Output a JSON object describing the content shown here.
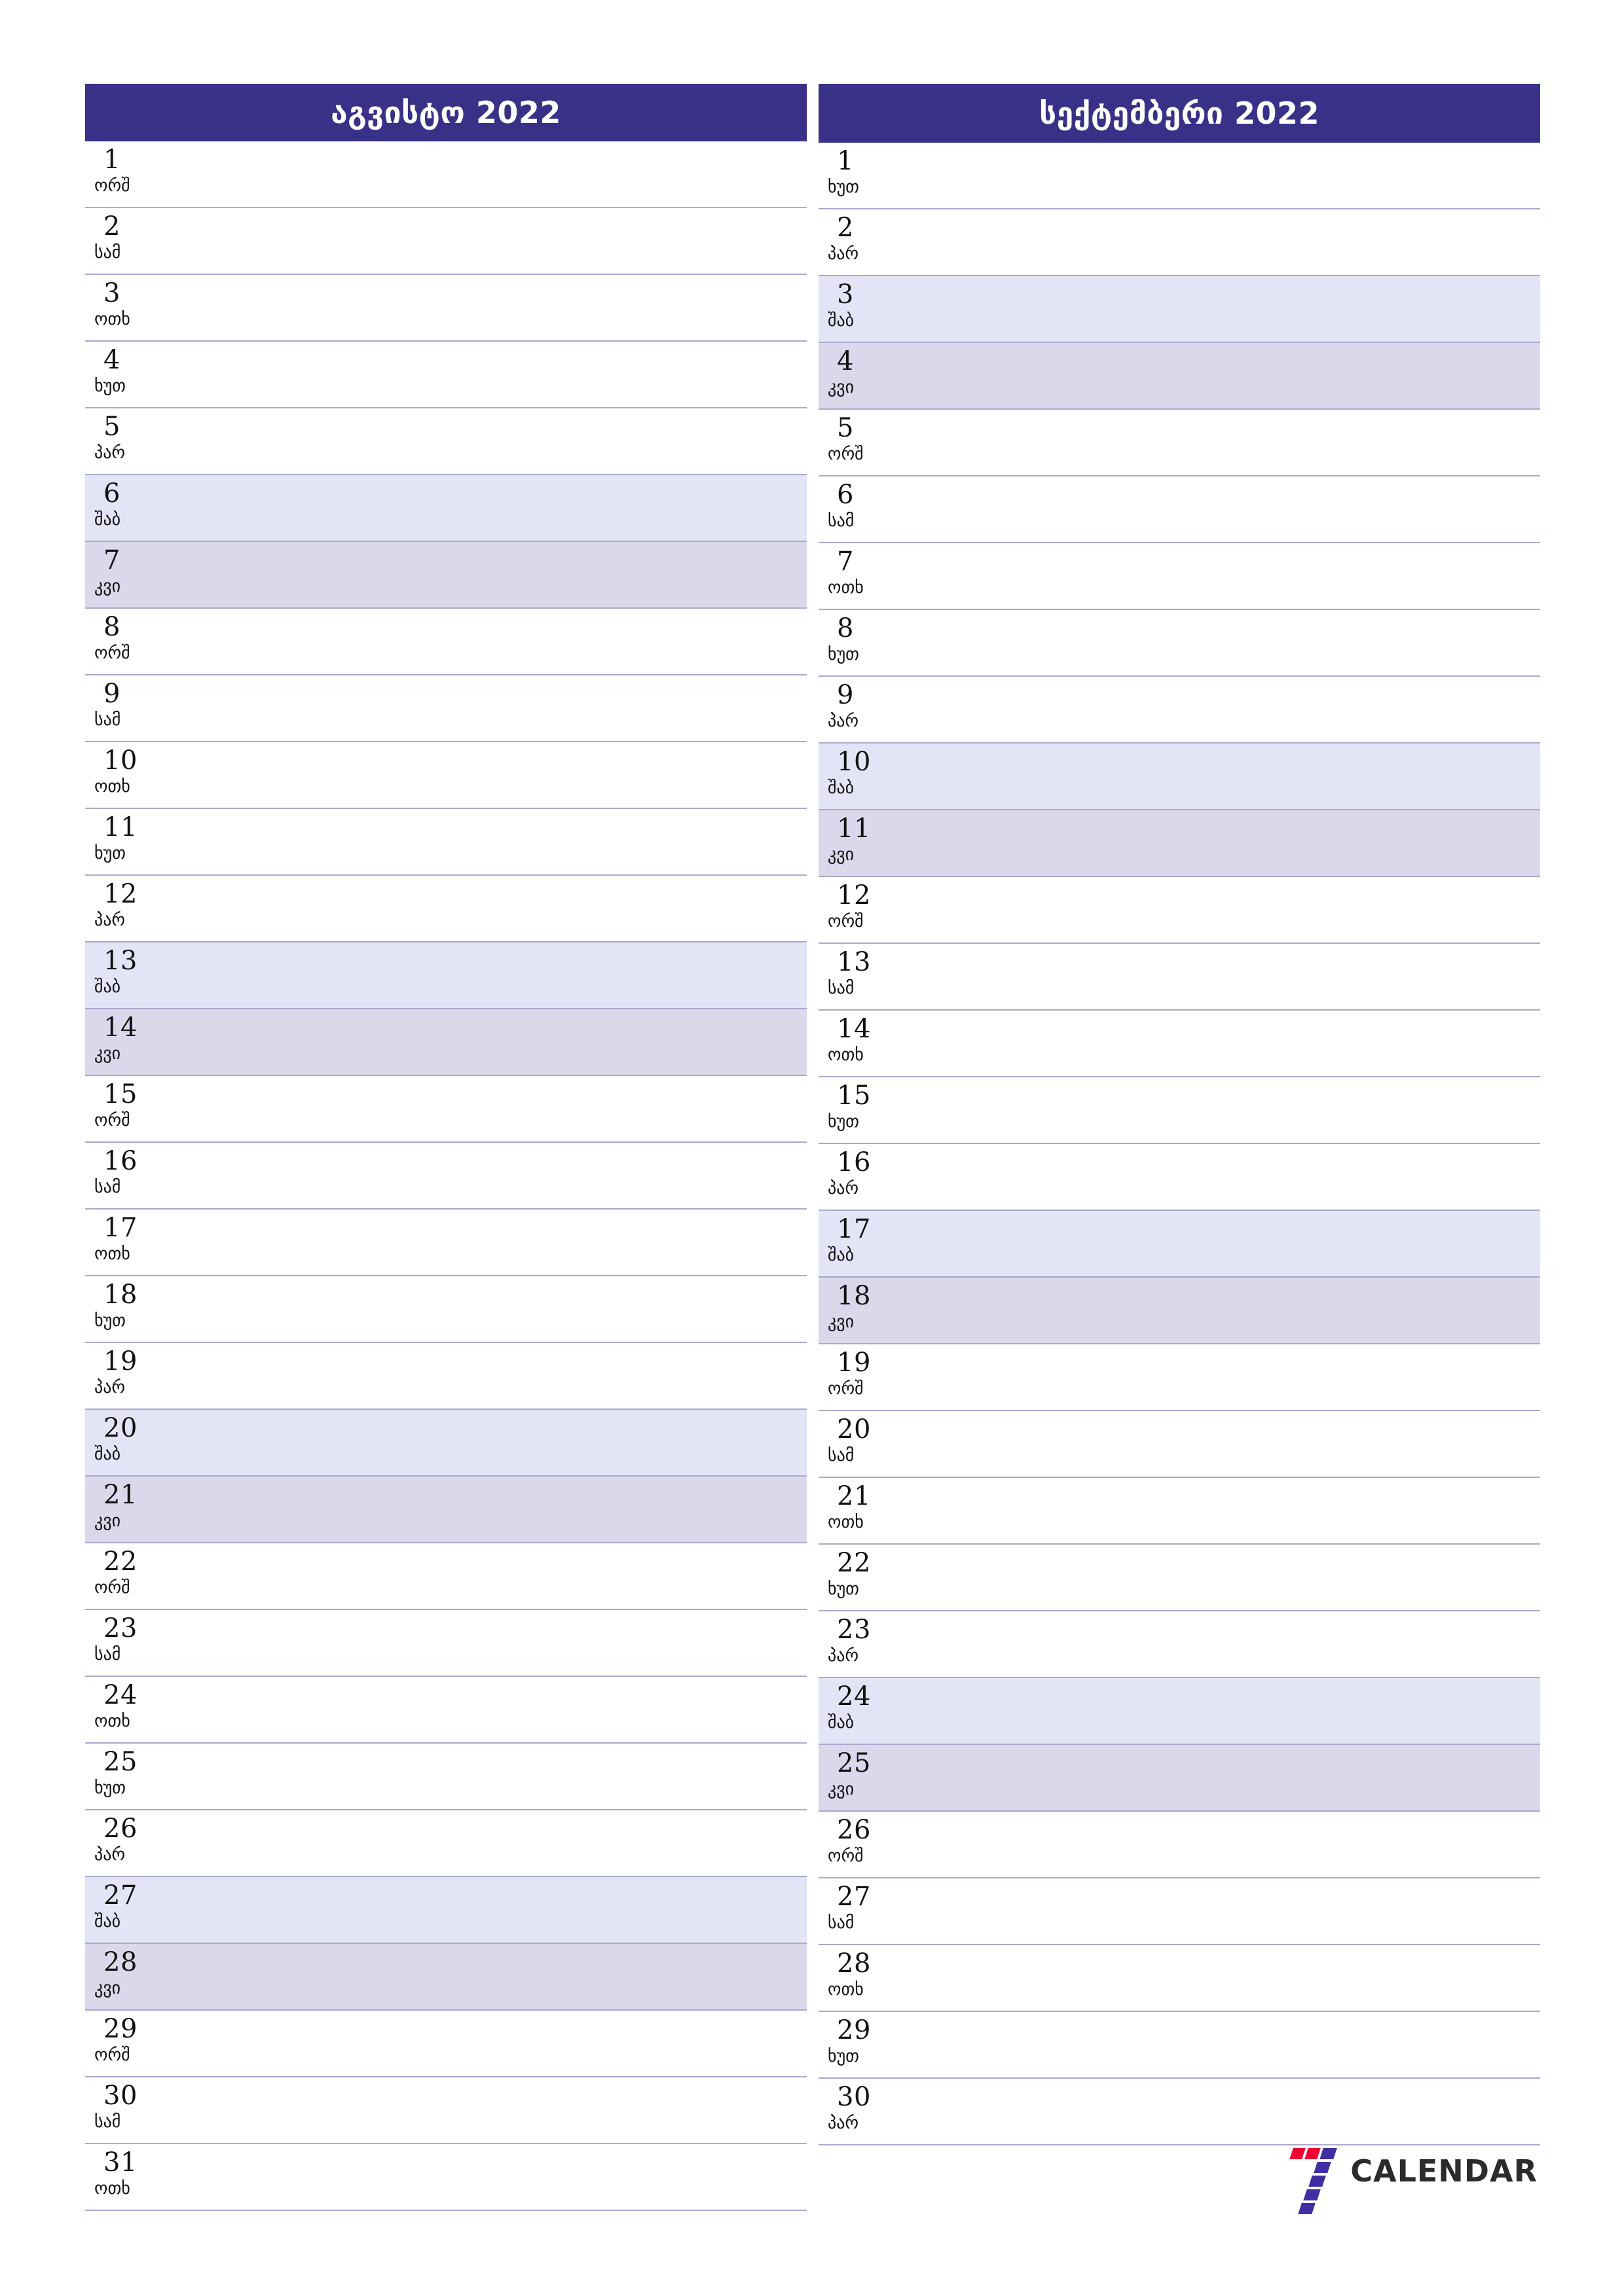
{
  "page": {
    "title": "August 2022 / September 2022 monthly planner",
    "accent_color": "#393087",
    "saturday_color": "#e4e4f7",
    "sunday_color": "#dcd8ec",
    "separator_color": "#a9a9cd"
  },
  "logo": {
    "text": "CALENDAR",
    "mark_name": "seven-logo-mark",
    "mark_colors": [
      "#ef0434",
      "#ef0434",
      "#3f2fa3",
      "#3f2fa3",
      "#3f2fa3",
      "#3f2fa3",
      "#3f2fa3"
    ]
  },
  "weekday_names": {
    "mon": "ორშ",
    "tue": "სამ",
    "wed": "ოთხ",
    "thu": "ხუთ",
    "fri": "პარ",
    "sat": "შაბ",
    "sun": "კვი"
  },
  "months": [
    {
      "title": "აგვისტო 2022",
      "days": [
        {
          "num": "1",
          "wd": "ორშ",
          "type": "weekday"
        },
        {
          "num": "2",
          "wd": "სამ",
          "type": "weekday"
        },
        {
          "num": "3",
          "wd": "ოთხ",
          "type": "weekday"
        },
        {
          "num": "4",
          "wd": "ხუთ",
          "type": "weekday"
        },
        {
          "num": "5",
          "wd": "პარ",
          "type": "weekday"
        },
        {
          "num": "6",
          "wd": "შაბ",
          "type": "sat"
        },
        {
          "num": "7",
          "wd": "კვი",
          "type": "sun"
        },
        {
          "num": "8",
          "wd": "ორშ",
          "type": "weekday"
        },
        {
          "num": "9",
          "wd": "სამ",
          "type": "weekday"
        },
        {
          "num": "10",
          "wd": "ოთხ",
          "type": "weekday"
        },
        {
          "num": "11",
          "wd": "ხუთ",
          "type": "weekday"
        },
        {
          "num": "12",
          "wd": "პარ",
          "type": "weekday"
        },
        {
          "num": "13",
          "wd": "შაბ",
          "type": "sat"
        },
        {
          "num": "14",
          "wd": "კვი",
          "type": "sun"
        },
        {
          "num": "15",
          "wd": "ორშ",
          "type": "weekday"
        },
        {
          "num": "16",
          "wd": "სამ",
          "type": "weekday"
        },
        {
          "num": "17",
          "wd": "ოთხ",
          "type": "weekday"
        },
        {
          "num": "18",
          "wd": "ხუთ",
          "type": "weekday"
        },
        {
          "num": "19",
          "wd": "პარ",
          "type": "weekday"
        },
        {
          "num": "20",
          "wd": "შაბ",
          "type": "sat"
        },
        {
          "num": "21",
          "wd": "კვი",
          "type": "sun"
        },
        {
          "num": "22",
          "wd": "ორშ",
          "type": "weekday"
        },
        {
          "num": "23",
          "wd": "სამ",
          "type": "weekday"
        },
        {
          "num": "24",
          "wd": "ოთხ",
          "type": "weekday"
        },
        {
          "num": "25",
          "wd": "ხუთ",
          "type": "weekday"
        },
        {
          "num": "26",
          "wd": "პარ",
          "type": "weekday"
        },
        {
          "num": "27",
          "wd": "შაბ",
          "type": "sat"
        },
        {
          "num": "28",
          "wd": "კვი",
          "type": "sun"
        },
        {
          "num": "29",
          "wd": "ორშ",
          "type": "weekday"
        },
        {
          "num": "30",
          "wd": "სამ",
          "type": "weekday"
        },
        {
          "num": "31",
          "wd": "ოთხ",
          "type": "weekday"
        }
      ]
    },
    {
      "title": "სექტემბერი 2022",
      "days": [
        {
          "num": "1",
          "wd": "ხუთ",
          "type": "weekday"
        },
        {
          "num": "2",
          "wd": "პარ",
          "type": "weekday"
        },
        {
          "num": "3",
          "wd": "შაბ",
          "type": "sat"
        },
        {
          "num": "4",
          "wd": "კვი",
          "type": "sun"
        },
        {
          "num": "5",
          "wd": "ორშ",
          "type": "weekday"
        },
        {
          "num": "6",
          "wd": "სამ",
          "type": "weekday"
        },
        {
          "num": "7",
          "wd": "ოთხ",
          "type": "weekday"
        },
        {
          "num": "8",
          "wd": "ხუთ",
          "type": "weekday"
        },
        {
          "num": "9",
          "wd": "პარ",
          "type": "weekday"
        },
        {
          "num": "10",
          "wd": "შაბ",
          "type": "sat"
        },
        {
          "num": "11",
          "wd": "კვი",
          "type": "sun"
        },
        {
          "num": "12",
          "wd": "ორშ",
          "type": "weekday"
        },
        {
          "num": "13",
          "wd": "სამ",
          "type": "weekday"
        },
        {
          "num": "14",
          "wd": "ოთხ",
          "type": "weekday"
        },
        {
          "num": "15",
          "wd": "ხუთ",
          "type": "weekday"
        },
        {
          "num": "16",
          "wd": "პარ",
          "type": "weekday"
        },
        {
          "num": "17",
          "wd": "შაბ",
          "type": "sat"
        },
        {
          "num": "18",
          "wd": "კვი",
          "type": "sun"
        },
        {
          "num": "19",
          "wd": "ორშ",
          "type": "weekday"
        },
        {
          "num": "20",
          "wd": "სამ",
          "type": "weekday"
        },
        {
          "num": "21",
          "wd": "ოთხ",
          "type": "weekday"
        },
        {
          "num": "22",
          "wd": "ხუთ",
          "type": "weekday"
        },
        {
          "num": "23",
          "wd": "პარ",
          "type": "weekday"
        },
        {
          "num": "24",
          "wd": "შაბ",
          "type": "sat"
        },
        {
          "num": "25",
          "wd": "კვი",
          "type": "sun"
        },
        {
          "num": "26",
          "wd": "ორშ",
          "type": "weekday"
        },
        {
          "num": "27",
          "wd": "სამ",
          "type": "weekday"
        },
        {
          "num": "28",
          "wd": "ოთხ",
          "type": "weekday"
        },
        {
          "num": "29",
          "wd": "ხუთ",
          "type": "weekday"
        },
        {
          "num": "30",
          "wd": "პარ",
          "type": "weekday"
        }
      ]
    }
  ]
}
